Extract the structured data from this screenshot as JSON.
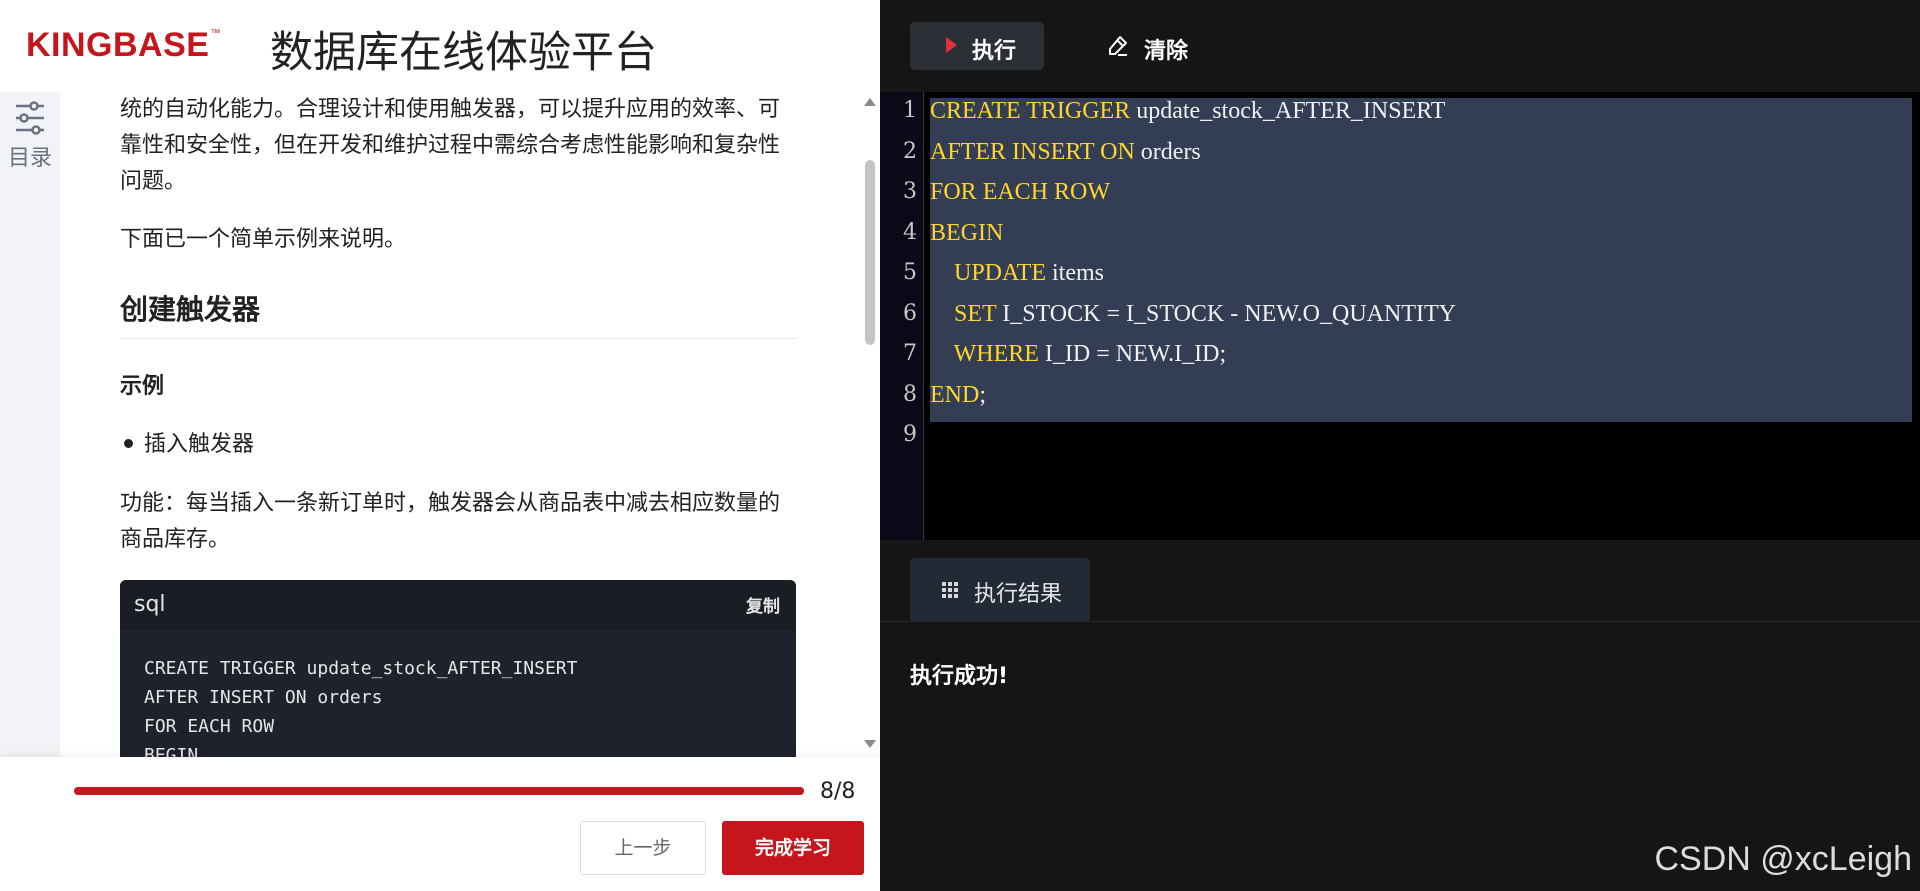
{
  "brand": {
    "logo_text": "KINGBASE",
    "logo_tm": "™",
    "platform_title": "数据库在线体验平台"
  },
  "toc": {
    "label": "目录"
  },
  "doc": {
    "para_intro": "统的自动化能力。合理设计和使用触发器，可以提升应用的效率、可靠性和安全性，但在开发和维护过程中需综合考虑性能影响和复杂性问题。",
    "para_example_intro": "下面已一个简单示例来说明。",
    "heading_create": "创建触发器",
    "heading_example": "示例",
    "bullet_insert": "插入触发器",
    "para_function": "功能：每当插入一条新订单时，触发器会从商品表中减去相应数量的商品库存。",
    "code_card": {
      "lang": "sql",
      "copy_label": "复制",
      "code": "CREATE TRIGGER update_stock_AFTER_INSERT\nAFTER INSERT ON orders\nFOR EACH ROW\nBEGIN"
    }
  },
  "footer": {
    "progress_text": "8/8",
    "progress_value": 1.0,
    "prev_label": "上一步",
    "finish_label": "完成学习"
  },
  "toolbar": {
    "run_label": "执行",
    "clear_label": "清除"
  },
  "editor": {
    "line_numbers": [
      "1",
      "2",
      "3",
      "4",
      "5",
      "6",
      "7",
      "8",
      "9"
    ],
    "lines": [
      {
        "indent": "",
        "kw": "CREATE TRIGGER",
        "rest": " update_stock_AFTER_INSERT"
      },
      {
        "indent": "",
        "kw": "AFTER INSERT ON",
        "rest": " orders"
      },
      {
        "indent": "",
        "kw": "FOR EACH ROW",
        "rest": ""
      },
      {
        "indent": "",
        "kw": "BEGIN",
        "rest": ""
      },
      {
        "indent": "    ",
        "kw": "UPDATE",
        "rest": " items"
      },
      {
        "indent": "    ",
        "kw": "SET",
        "rest": " I_STOCK = I_STOCK - NEW.O_QUANTITY"
      },
      {
        "indent": "    ",
        "kw": "WHERE",
        "rest": " I_ID = NEW.I_ID;"
      },
      {
        "indent": "",
        "kw": "END",
        "rest": ";"
      },
      {
        "indent": "",
        "kw": "",
        "rest": ""
      }
    ]
  },
  "results": {
    "tab_label": "执行结果",
    "message": "执行成功!"
  },
  "watermark": "CSDN @xcLeigh",
  "colors": {
    "brand_red": "#c4161c",
    "keyword_yellow": "#ffd52e",
    "selection_bg": "#333d53"
  }
}
